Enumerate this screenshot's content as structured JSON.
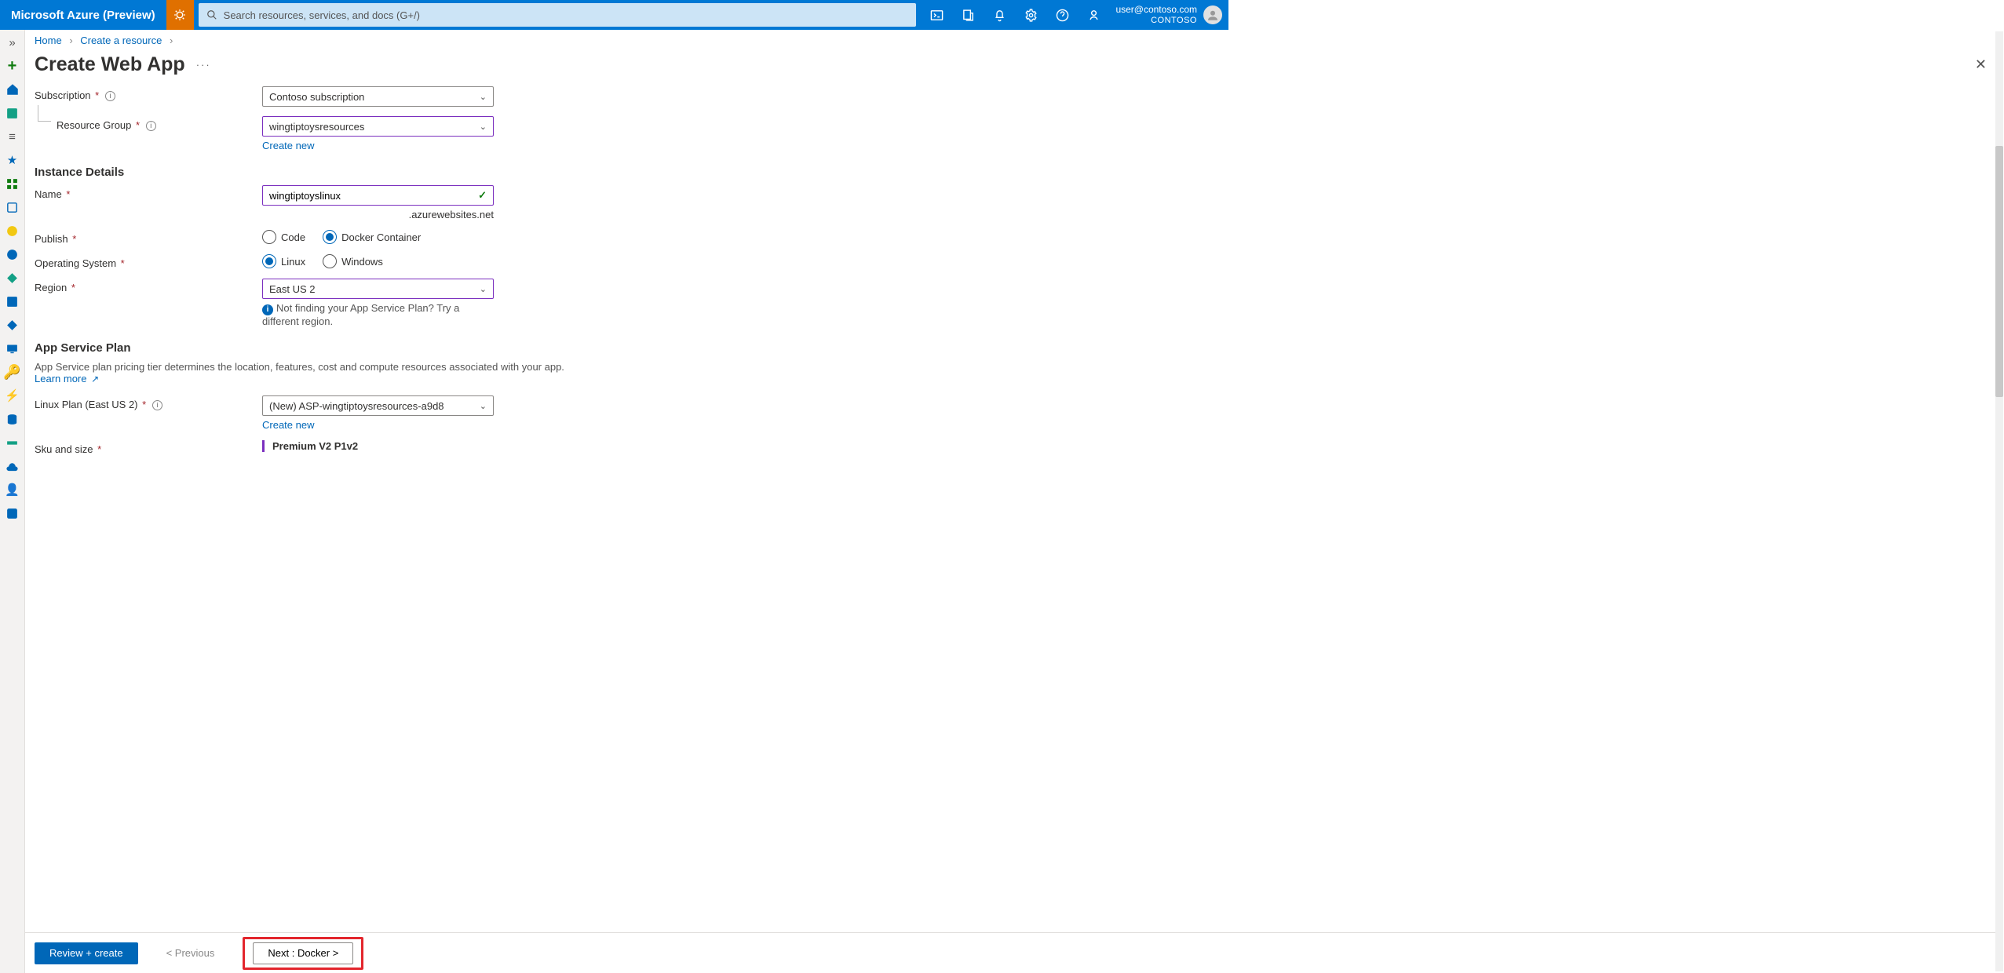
{
  "top": {
    "brand": "Microsoft Azure (Preview)",
    "search_placeholder": "Search resources, services, and docs (G+/)",
    "email": "user@contoso.com",
    "tenant": "CONTOSO"
  },
  "crumb": {
    "home": "Home",
    "create": "Create a resource"
  },
  "title": "Create Web App",
  "form": {
    "subscription_label": "Subscription",
    "subscription_value": "Contoso subscription",
    "rg_label": "Resource Group",
    "rg_value": "wingtiptoysresources",
    "rg_create": "Create new",
    "instance_header": "Instance Details",
    "name_label": "Name",
    "name_value": "wingtiptoyslinux",
    "name_suffix": ".azurewebsites.net",
    "publish_label": "Publish",
    "publish_code": "Code",
    "publish_docker": "Docker Container",
    "os_label": "Operating System",
    "os_linux": "Linux",
    "os_windows": "Windows",
    "region_label": "Region",
    "region_value": "East US 2",
    "region_hint": "Not finding your App Service Plan? Try a different region.",
    "plan_header": "App Service Plan",
    "plan_desc": "App Service plan pricing tier determines the location, features, cost and compute resources associated with your app.",
    "plan_learn": "Learn more",
    "plan_label": "Linux Plan (East US 2)",
    "plan_value": "(New) ASP-wingtiptoysresources-a9d8",
    "plan_create": "Create new",
    "sku_label": "Sku and size",
    "sku_value": "Premium V2 P1v2"
  },
  "footer": {
    "review": "Review + create",
    "prev": "< Previous",
    "next": "Next : Docker >"
  }
}
